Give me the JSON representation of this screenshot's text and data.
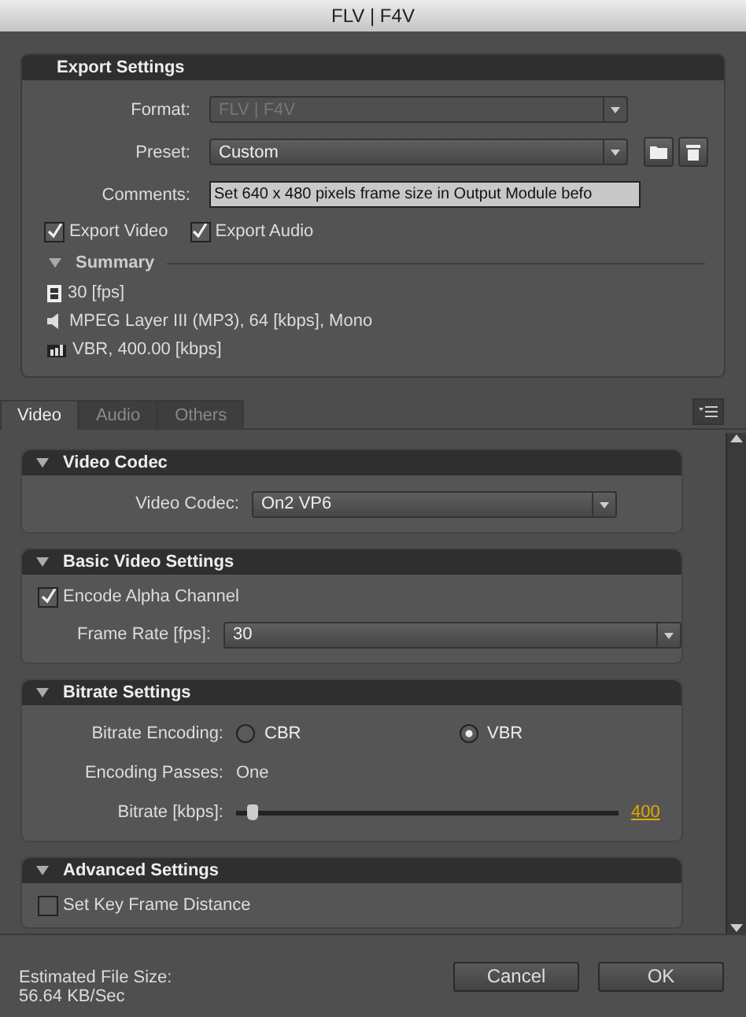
{
  "window": {
    "title": "FLV | F4V"
  },
  "export_settings": {
    "title": "Export Settings",
    "format": {
      "label": "Format:",
      "value": "FLV | F4V",
      "disabled": true
    },
    "preset": {
      "label": "Preset:",
      "value": "Custom",
      "disabled": false
    },
    "comments": {
      "label": "Comments:",
      "value": "Set 640 x 480 pixels frame size in Output Module befo"
    },
    "checkboxes": [
      {
        "label": "Export Video",
        "checked": true
      },
      {
        "label": "Export Audio",
        "checked": true
      }
    ],
    "summary": {
      "title": "Summary",
      "expanded": true,
      "items": [
        {
          "kind": "video",
          "text": "30 [fps]"
        },
        {
          "kind": "audio",
          "text": "MPEG Layer III (MP3), 64 [kbps], Mono"
        },
        {
          "kind": "bitrate",
          "text": "VBR, 400.00 [kbps]"
        }
      ]
    }
  },
  "tabs": [
    {
      "label": "Video",
      "selected": true
    },
    {
      "label": "Audio",
      "selected": false
    },
    {
      "label": "Others",
      "selected": false
    }
  ],
  "sections": [
    {
      "title": "Video Codec",
      "expanded": true,
      "rows": [
        {
          "kind": "select",
          "label": "Video Codec:",
          "value": "On2 VP6",
          "wide": false
        }
      ]
    },
    {
      "title": "Basic Video Settings",
      "expanded": true,
      "rows": [
        {
          "kind": "checkbox",
          "label": "Encode Alpha Channel",
          "checked": true
        },
        {
          "kind": "select",
          "label": "Frame Rate [fps]:",
          "value": "30",
          "wide": true
        }
      ]
    },
    {
      "title": "Bitrate Settings",
      "expanded": true,
      "rows": [
        {
          "kind": "radio",
          "label": "Bitrate Encoding:",
          "options": [
            {
              "label": "CBR",
              "selected": false
            },
            {
              "label": "VBR",
              "selected": true
            }
          ]
        },
        {
          "kind": "text",
          "label": "Encoding Passes:",
          "value": "One"
        },
        {
          "kind": "slider",
          "label": "Bitrate [kbps]:",
          "level": 0.04,
          "reading": "400"
        }
      ]
    },
    {
      "title": "Advanced Settings",
      "expanded": true,
      "rows": [
        {
          "kind": "checkbox",
          "label": "Set Key Frame Distance",
          "checked": false
        }
      ]
    }
  ],
  "footer": {
    "estimate_label": "Estimated File Size:",
    "estimate_value": "56.64 KB/Sec",
    "buttons": [
      "Cancel",
      "OK"
    ]
  }
}
